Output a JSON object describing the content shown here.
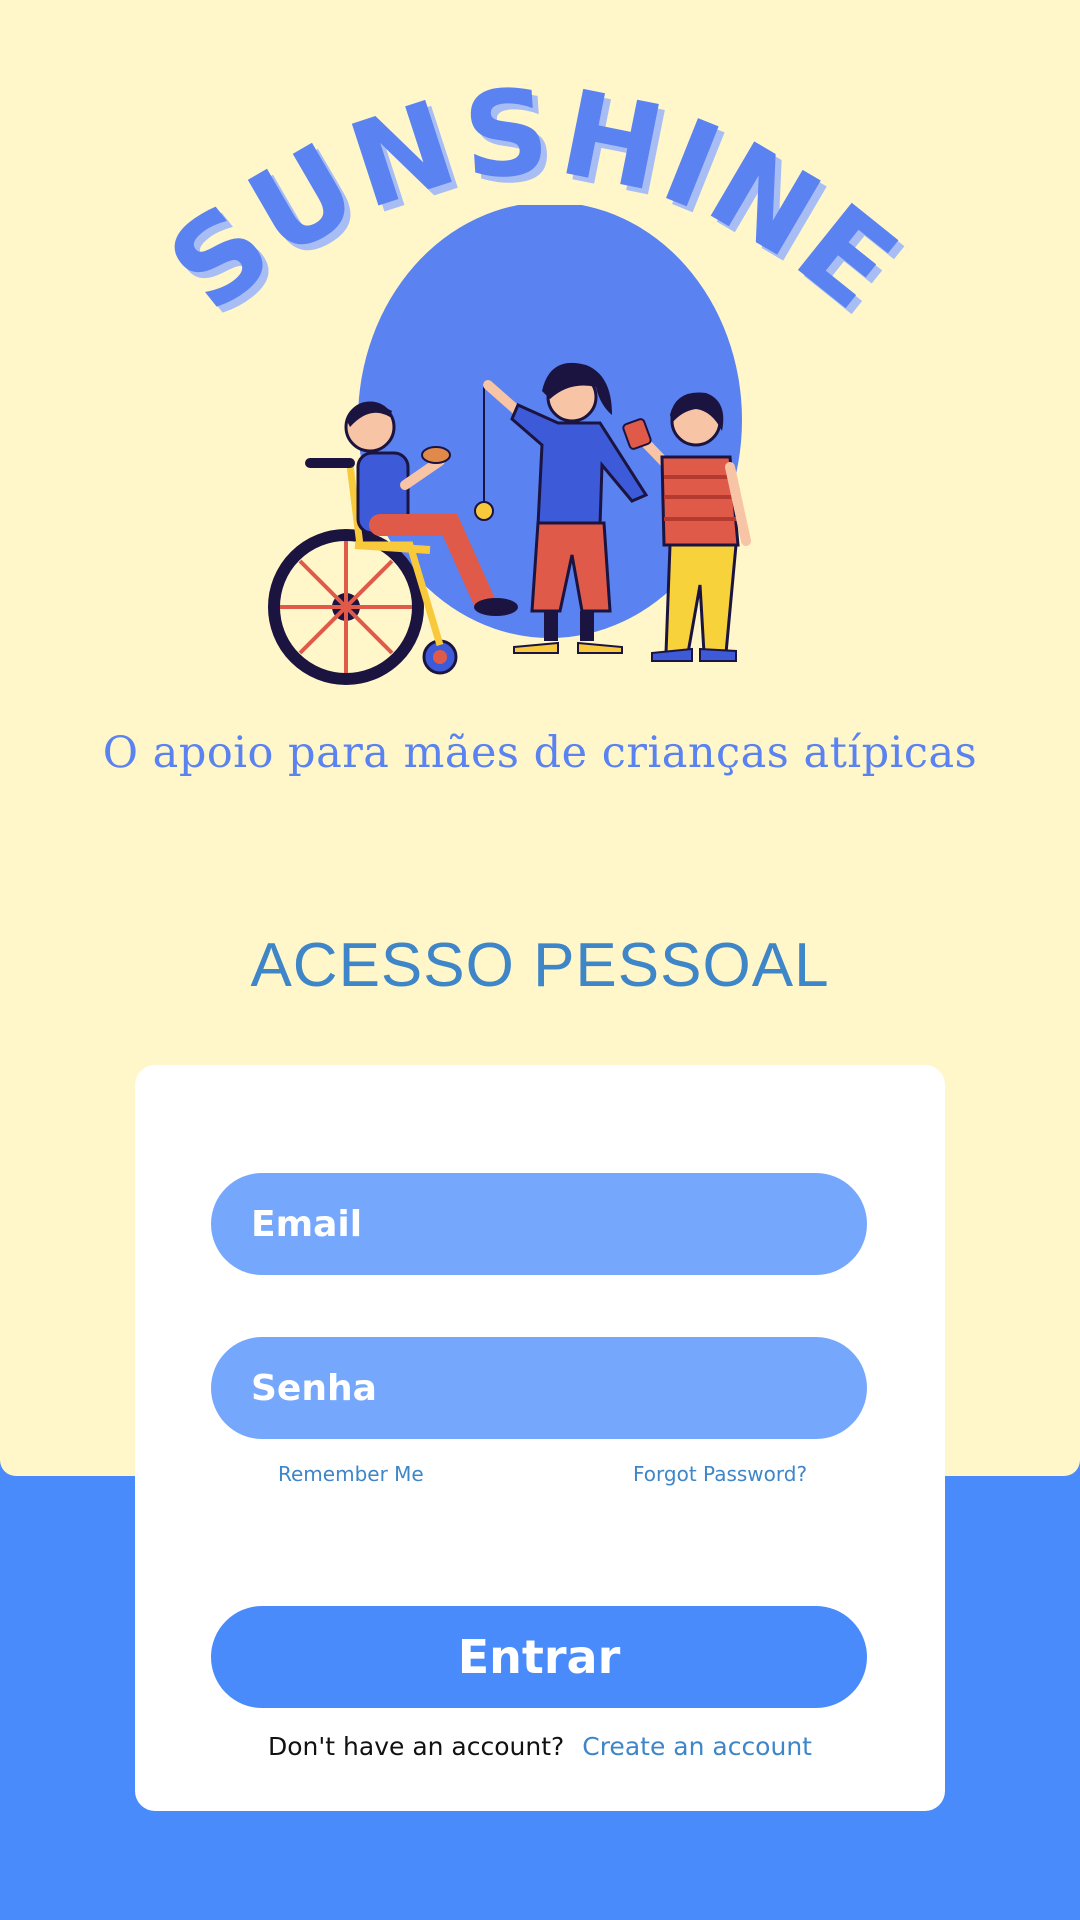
{
  "brand": {
    "name": "SUNSHINE",
    "tagline": "O apoio para mães de crianças atípicas"
  },
  "login": {
    "title": "ACESSO PESSOAL",
    "email_placeholder": "Email",
    "password_placeholder": "Senha",
    "remember_me": "Remember Me",
    "forgot_password": "Forgot Password?",
    "submit_label": "Entrar",
    "no_account_text": "Don't have an account?",
    "create_account_link": "Create an account"
  },
  "colors": {
    "background_top": "#fff7c9",
    "background_bottom": "#4a8bfc",
    "accent": "#4a8bfc",
    "input_fill": "#75a8fd",
    "link": "#3e86c8"
  },
  "icons": {
    "hero": "children-playing-illustration"
  }
}
